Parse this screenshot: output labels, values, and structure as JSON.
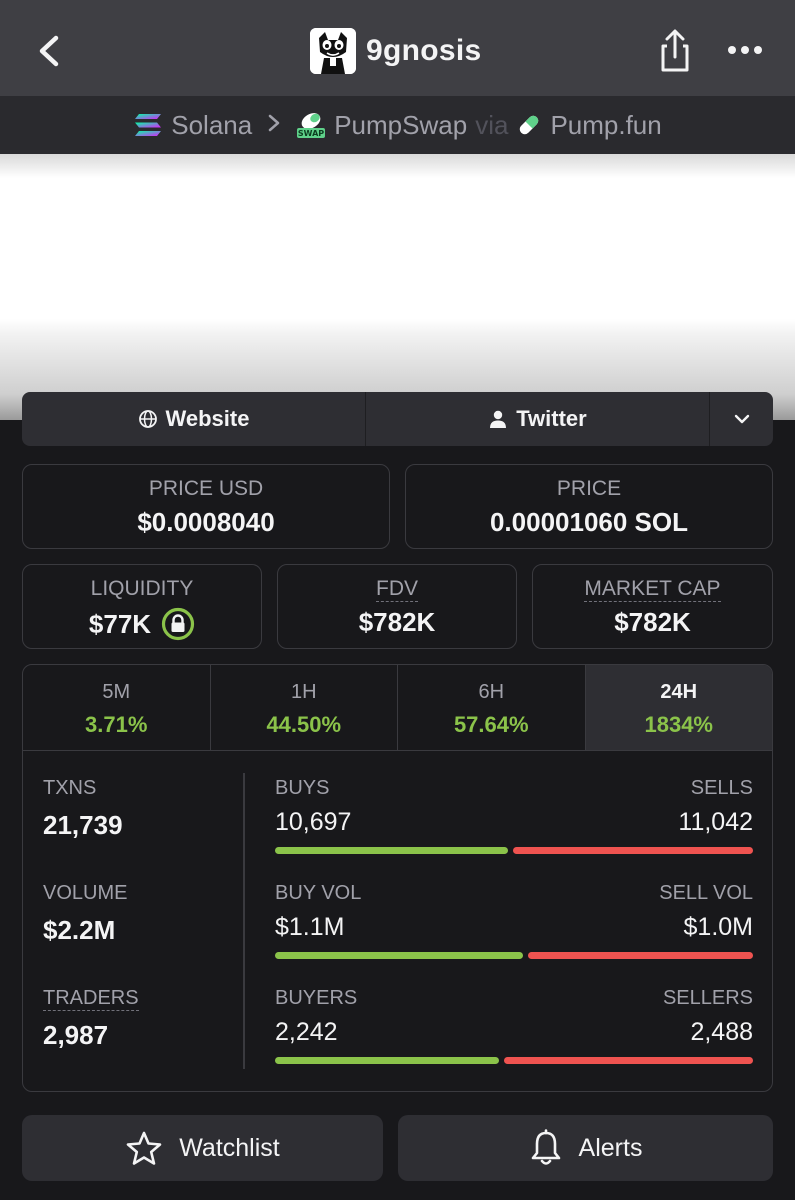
{
  "header": {
    "title": "9gnosis"
  },
  "breadcrumb": {
    "chain": "Solana",
    "dex": "PumpSwap",
    "via": "via",
    "launchpad": "Pump.fun",
    "dex_badge": "SWAP"
  },
  "links": {
    "website": "Website",
    "twitter": "Twitter"
  },
  "price": {
    "usd_label": "PRICE USD",
    "usd_value": "$0.0008040",
    "native_label": "PRICE",
    "native_value": "0.00001060 SOL"
  },
  "metrics": {
    "liquidity_label": "LIQUIDITY",
    "liquidity_value": "$77K",
    "fdv_label": "FDV",
    "fdv_value": "$782K",
    "mcap_label": "MARKET CAP",
    "mcap_value": "$782K"
  },
  "timeframes": [
    {
      "label": "5M",
      "value": "3.71%"
    },
    {
      "label": "1H",
      "value": "44.50%"
    },
    {
      "label": "6H",
      "value": "57.64%"
    },
    {
      "label": "24H",
      "value": "1834%"
    }
  ],
  "summary": {
    "txns_label": "TXNS",
    "txns_value": "21,739",
    "volume_label": "VOLUME",
    "volume_value": "$2.2M",
    "traders_label": "TRADERS",
    "traders_value": "2,987"
  },
  "breakdown": {
    "buys_label": "BUYS",
    "buys_value": "10,697",
    "sells_label": "SELLS",
    "sells_value": "11,042",
    "buys_fraction": 0.492,
    "buyvol_label": "BUY VOL",
    "buyvol_value": "$1.1M",
    "sellvol_label": "SELL VOL",
    "sellvol_value": "$1.0M",
    "buyvol_fraction": 0.524,
    "buyers_label": "BUYERS",
    "buyers_value": "2,242",
    "sellers_label": "SELLERS",
    "sellers_value": "2,488",
    "buyers_fraction": 0.474
  },
  "actions": {
    "watchlist": "Watchlist",
    "alerts": "Alerts"
  },
  "colors": {
    "positive": "#8bc34a",
    "negative": "#ef5350",
    "background": "#18181b"
  }
}
